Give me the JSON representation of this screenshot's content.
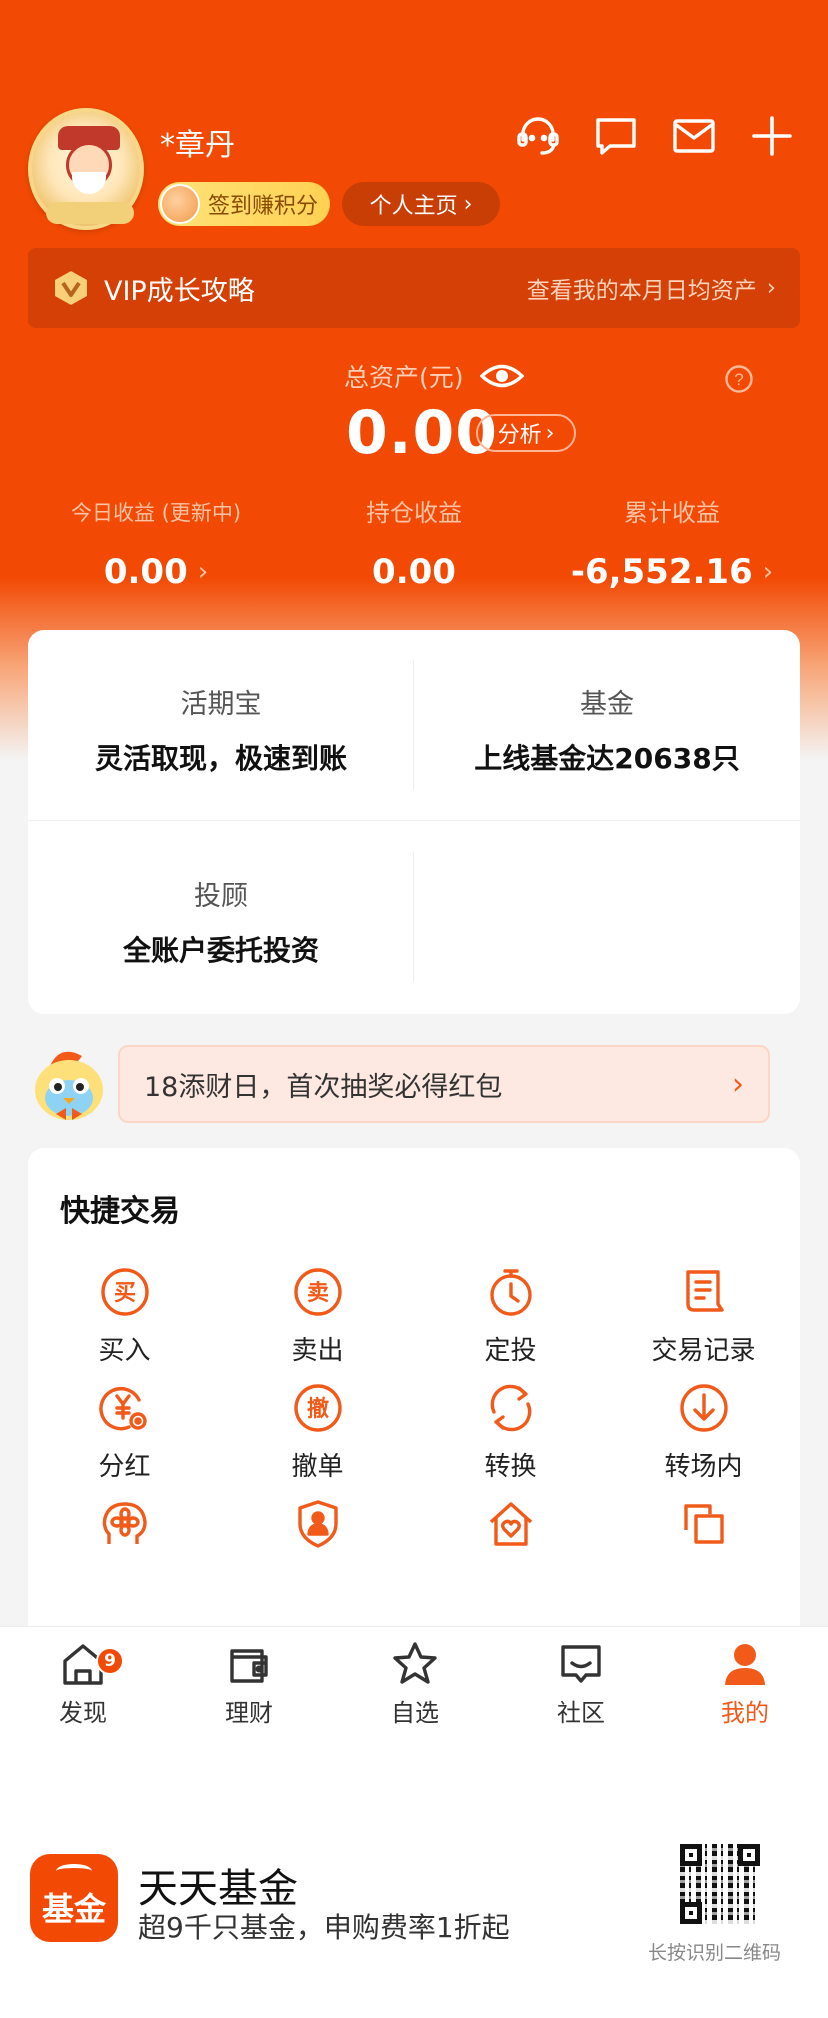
{
  "header": {
    "username": "*章丹",
    "checkin_label": "签到赚积分",
    "homepage_label": "个人主页",
    "icons": [
      "customer-service-icon",
      "message-icon",
      "mail-icon",
      "plus-icon"
    ]
  },
  "vip": {
    "title": "VIP成长攻略",
    "link": "查看我的本月日均资产"
  },
  "assets": {
    "total_label": "总资产(元)",
    "total_value": "0.00",
    "analysis_label": "分析",
    "stats": [
      {
        "label": "今日收益 (更新中)",
        "value": "0.00"
      },
      {
        "label": "持仓收益",
        "value": "0.00"
      },
      {
        "label": "累计收益",
        "value": "-6,552.16"
      }
    ]
  },
  "products": [
    {
      "title": "活期宝",
      "subtitle": "灵活取现，极速到账"
    },
    {
      "title": "基金",
      "subtitle": "上线基金达20638只"
    },
    {
      "title": "投顾",
      "subtitle": "全账户委托投资"
    }
  ],
  "promo": {
    "text": "18添财日，首次抽奖必得红包"
  },
  "quick_trade": {
    "title": "快捷交易",
    "items": [
      {
        "label": "买入",
        "icon": "buy-icon"
      },
      {
        "label": "卖出",
        "icon": "sell-icon"
      },
      {
        "label": "定投",
        "icon": "timer-icon"
      },
      {
        "label": "交易记录",
        "icon": "record-icon"
      },
      {
        "label": "分红",
        "icon": "dividend-icon"
      },
      {
        "label": "撤单",
        "icon": "cancel-order-icon"
      },
      {
        "label": "转换",
        "icon": "convert-icon"
      },
      {
        "label": "转场内",
        "icon": "transfer-icon"
      }
    ],
    "cut_icons": [
      "flower-icon",
      "shield-person-icon",
      "house-heart-icon",
      "copy-icon"
    ]
  },
  "nav": {
    "tabs": [
      {
        "label": "发现",
        "icon": "home-icon",
        "badge": "9"
      },
      {
        "label": "理财",
        "icon": "wallet-icon"
      },
      {
        "label": "自选",
        "icon": "star-icon"
      },
      {
        "label": "社区",
        "icon": "community-icon"
      },
      {
        "label": "我的",
        "icon": "profile-icon"
      }
    ]
  },
  "footer": {
    "app_logo_text": "基金",
    "app_name": "天天基金",
    "slogan": "超9千只基金，申购费率1折起",
    "qr_caption": "长按识别二维码"
  },
  "colors": {
    "brand": "#f24a05",
    "accent": "#f25a1a",
    "vip_bar": "#d44006"
  }
}
